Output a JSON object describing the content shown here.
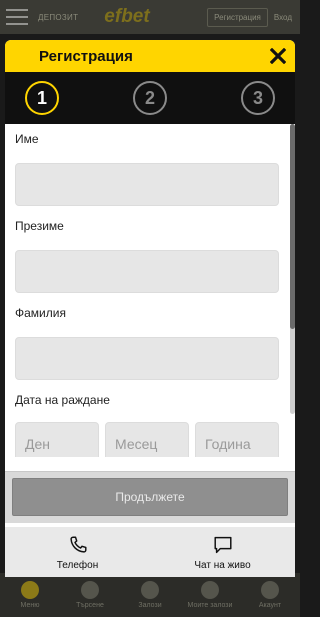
{
  "background": {
    "deposit_label": "ДЕПОЗИТ",
    "logo_text": "efbet",
    "register_label": "Регистрация",
    "login_label": "Вход",
    "nav": [
      {
        "label": "Меню"
      },
      {
        "label": "Търсене"
      },
      {
        "label": "Залози"
      },
      {
        "label": "Моите залози"
      },
      {
        "label": "Акаунт"
      }
    ]
  },
  "modal": {
    "title": "Регистрация",
    "close_icon": "close-icon",
    "steps": [
      "1",
      "2",
      "3"
    ],
    "active_step": 1,
    "fields": {
      "first_name_label": "Име",
      "middle_name_label": "Презиме",
      "last_name_label": "Фамилия",
      "birthdate_label": "Дата на раждане",
      "day_placeholder": "Ден",
      "month_placeholder": "Месец",
      "year_placeholder": "Година"
    },
    "continue_label": "Продължете",
    "support": {
      "phone_label": "Телефон",
      "chat_label": "Чат на живо"
    }
  },
  "colors": {
    "accent": "#ffd500",
    "steps_bg": "#101010",
    "button_disabled": "#8f8f8f"
  }
}
